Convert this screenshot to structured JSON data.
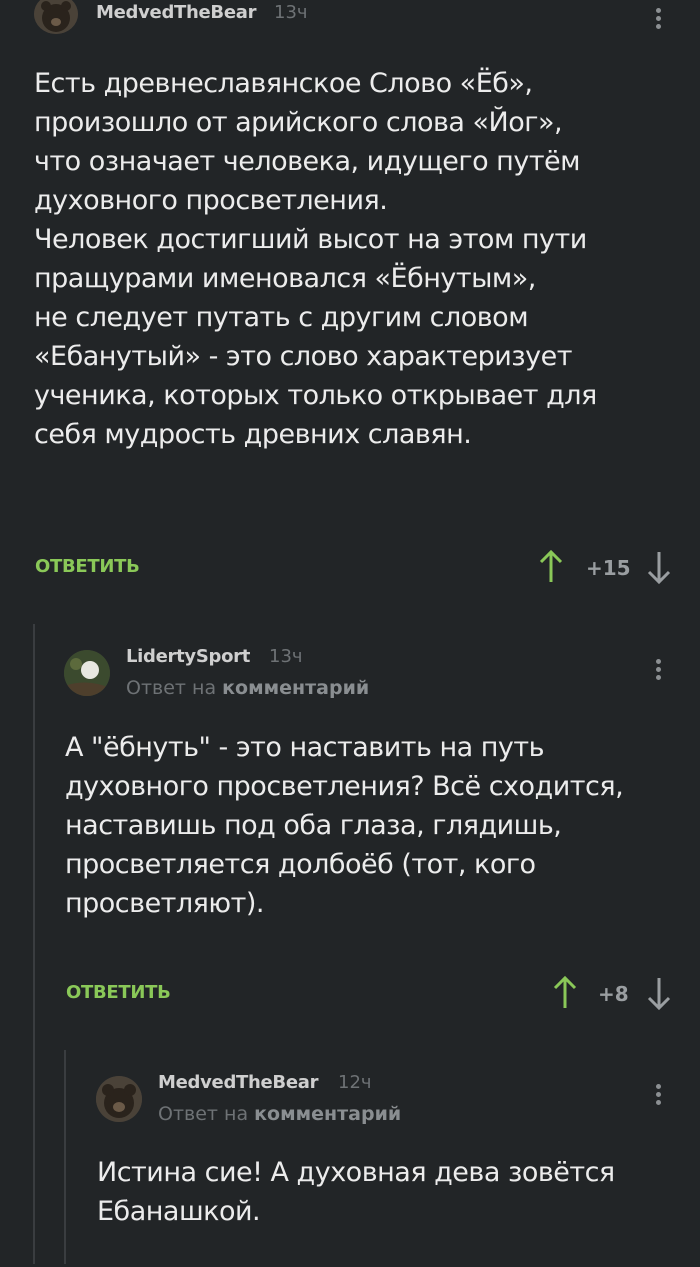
{
  "comments": [
    {
      "author": "MedvedTheBear",
      "time": "13ч",
      "text_lines": [
        "Есть древнеславянское Слово «Ёб»,",
        "произошло от арийского слова «Йог»,",
        "что означает человека, идущего путём",
        "духовного просветления.",
        "Человек достигший высот на этом пути",
        "пращурами именовался «Ёбнутым»,",
        "не следует путать с другим словом",
        "«Ебанутый» - это слово характеризует",
        "ученика, которых только открывает для",
        "себя мудрость древних славян."
      ],
      "reply_label": "ОТВЕТИТЬ",
      "rating": "+15"
    },
    {
      "author": "LidertySport",
      "time": "13ч",
      "reply_prefix": "Ответ на",
      "reply_target": "комментарий",
      "text_lines": [
        "А \"ёбнуть\" - это наставить на путь",
        "духовного просветления? Всё сходится,",
        "наставишь под оба глаза, глядишь,",
        "просветляется долбоёб (тот, кого",
        "просветляют)."
      ],
      "reply_label": "ОТВЕТИТЬ",
      "rating": "+8"
    },
    {
      "author": "MedvedTheBear",
      "time": "12ч",
      "reply_prefix": "Ответ на",
      "reply_target": "комментарий",
      "text_lines": [
        "Истина сие! А духовная дева зовётся",
        "Ебанашкой."
      ]
    }
  ],
  "colors": {
    "background": "#222527",
    "accent_green": "#8ac858",
    "muted": "#6e7275"
  }
}
